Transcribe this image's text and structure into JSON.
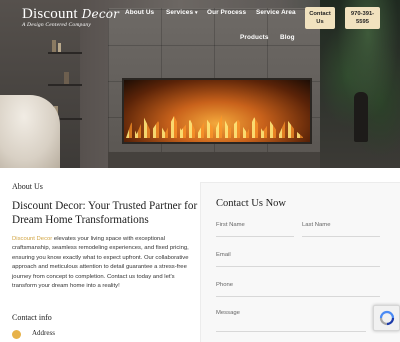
{
  "logo": {
    "name": "Discount",
    "name_script": "Decor",
    "tagline": "A Design Centered Company"
  },
  "nav": {
    "items": [
      "About Us",
      "Services",
      "Our Process",
      "Service Area",
      "Products",
      "Blog"
    ],
    "services_caret": "▾",
    "contact_button": "Contact Us",
    "phone_button": "970-391-5595"
  },
  "about": {
    "label": "About Us",
    "heading": "Discount Decor: Your Trusted Partner for Dream Home Transformations",
    "body_link": "Discount Decor",
    "body_text": " elevates your living space with exceptional craftsmanship, seamless remodeling experiences, and fixed pricing, ensuring you know exactly what to expect upfront.  Our collaborative approach and meticulous attention to detail guarantee a stress-free journey from concept to completion. Contact us today and let's transform your dream home into a reality!",
    "contact_info_label": "Contact info",
    "address_label": "Address"
  },
  "form": {
    "title": "Contact Us Now",
    "first_name": "First Name",
    "last_name": "Last Name",
    "email": "Email",
    "phone": "Phone",
    "message": "Message"
  },
  "colors": {
    "accent": "#f1e2bf",
    "link": "#d1a442",
    "icon": "#e7b24a"
  }
}
